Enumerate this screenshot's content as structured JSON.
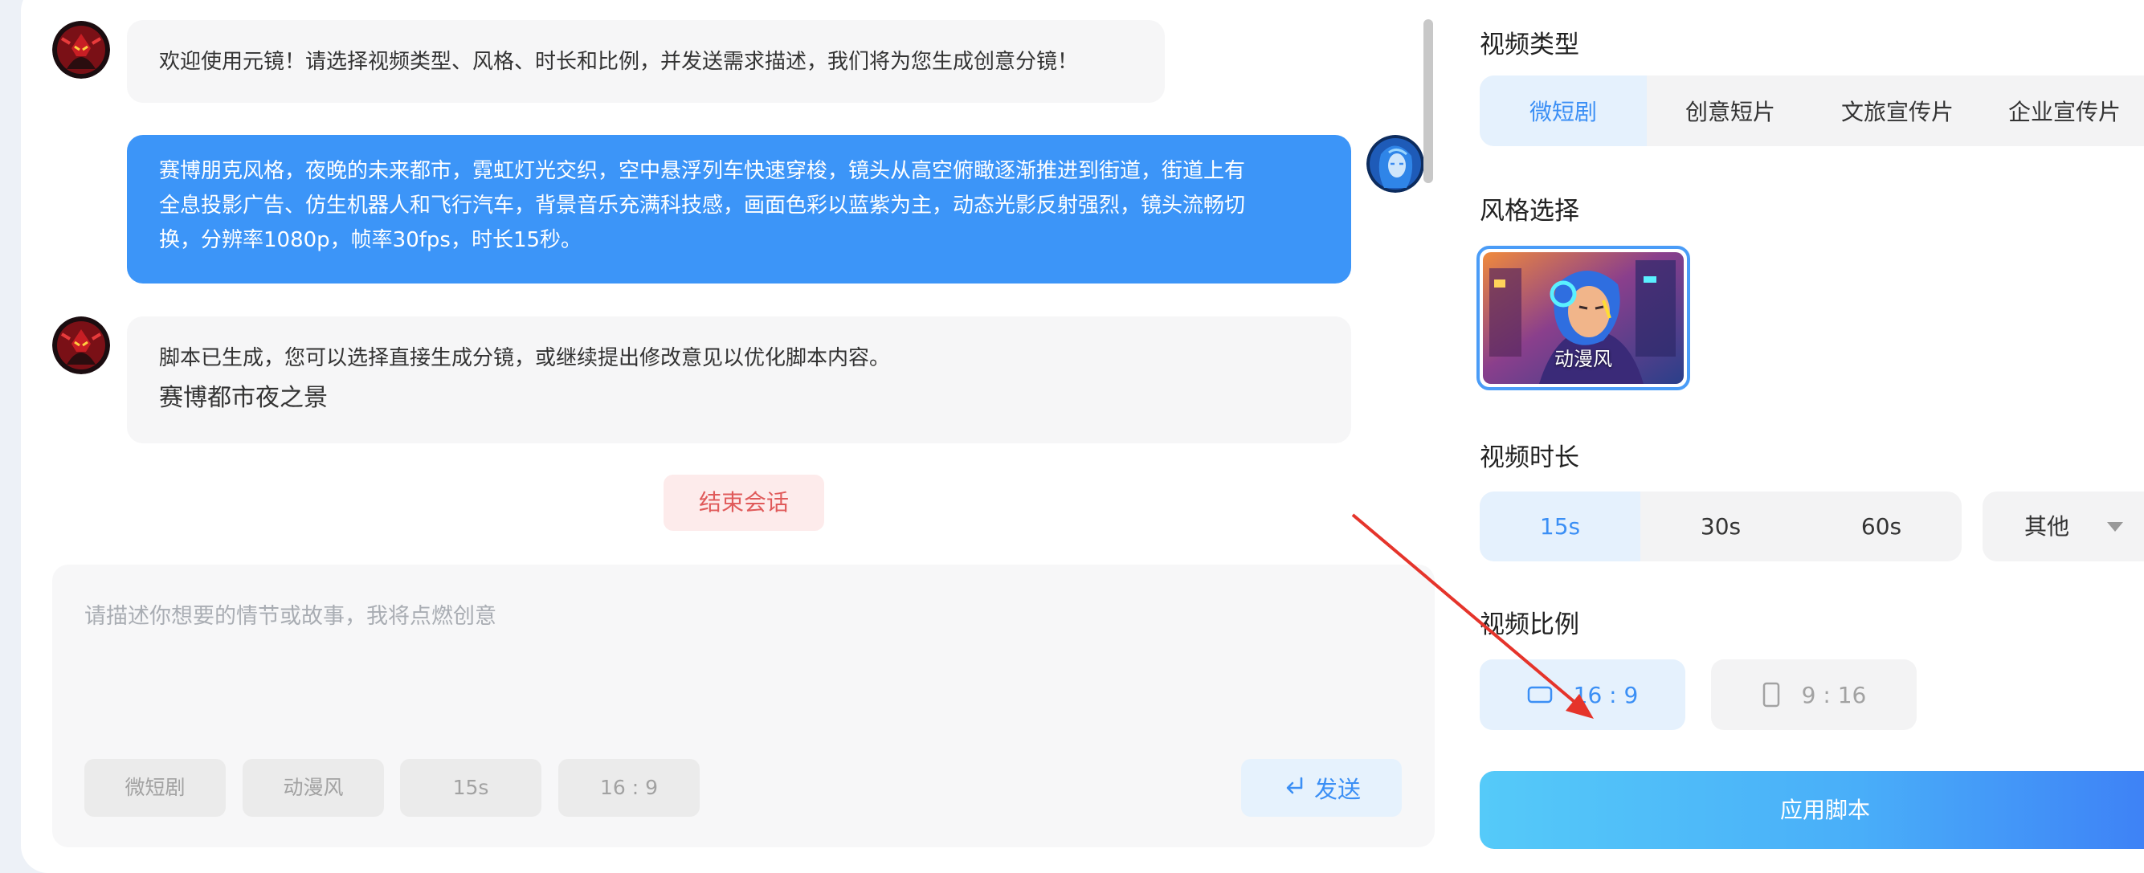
{
  "chat": {
    "welcome_message": "欢迎使用元镜！请选择视频类型、风格、时长和比例，并发送需求描述，我们将为您生成创意分镜！",
    "user_message_lines": [
      "赛博朋克风格，夜晚的未来都市，霓虹灯光交织，空中悬浮列车快速穿梭，镜头从高空俯瞰逐渐推进到街道，街道上有",
      "全息投影广告、仿生机器人和飞行汽车，背景音乐充满科技感，画面色彩以蓝紫为主，动态光影反射强烈，镜头流畅切",
      "换，分辨率1080p，帧率30fps，时长15秒。"
    ],
    "script_message": "脚本已生成，您可以选择直接生成分镜，或继续提出修改意见以优化脚本内容。",
    "script_title": "赛博都市夜之景",
    "end_session_label": "结束会话"
  },
  "composer": {
    "placeholder": "请描述你想要的情节或故事，我将点燃创意",
    "chips": [
      "微短剧",
      "动漫风",
      "15s",
      "16 : 9"
    ],
    "send_label": "发送"
  },
  "panel": {
    "video_type": {
      "title": "视频类型",
      "options": [
        "微短剧",
        "创意短片",
        "文旅宣传片",
        "企业宣传片"
      ],
      "selected": "微短剧"
    },
    "style": {
      "title": "风格选择",
      "options": [
        {
          "label": "动漫风",
          "selected": true
        }
      ]
    },
    "duration": {
      "title": "视频时长",
      "options": [
        "15s",
        "30s",
        "60s"
      ],
      "selected": "15s",
      "other_label": "其他"
    },
    "ratio": {
      "title": "视频比例",
      "options": [
        "16 : 9",
        "9 : 16"
      ],
      "selected": "16 : 9"
    },
    "apply_label": "应用脚本"
  },
  "colors": {
    "accent": "#3b8ff5",
    "user_bubble": "#3c95f8",
    "end_session_text": "#e05a5a",
    "annotation_arrow": "#e5342b"
  }
}
